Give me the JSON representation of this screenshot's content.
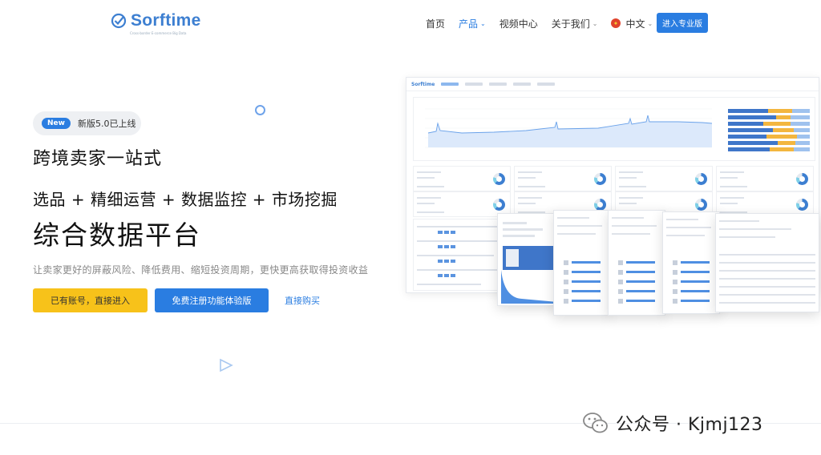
{
  "brand": {
    "name": "Sorftime",
    "tagline": "Cross-border E-commerce Big Data"
  },
  "nav": {
    "items": [
      {
        "label": "首页",
        "has_menu": false,
        "active": false
      },
      {
        "label": "产品",
        "has_menu": true,
        "active": true
      },
      {
        "label": "视频中心",
        "has_menu": false,
        "active": false
      },
      {
        "label": "关于我们",
        "has_menu": true,
        "active": false
      }
    ],
    "language": "中文",
    "cta": "进入专业版"
  },
  "hero": {
    "badge_tag": "New",
    "badge_text": "新版5.0已上线",
    "subtitle": "跨境卖家一站式",
    "features": "选品 + 精细运营 + 数据监控 + 市场挖掘",
    "title": "综合数据平台",
    "description": "让卖家更好的屏蔽风险、降低费用、缩短投资周期，更快更高获取得投资收益",
    "buttons": {
      "login": "已有账号，直接进入",
      "register": "免费注册功能体验版",
      "buy": "直接购买"
    }
  },
  "dashboard": {
    "logo": "Sorftime"
  },
  "watermark": {
    "text": "公众号 · Kjmj123"
  },
  "colors": {
    "accent": "#2a7de1",
    "cta_yellow": "#f7c21a",
    "brand_blue": "#3d7fd1"
  }
}
